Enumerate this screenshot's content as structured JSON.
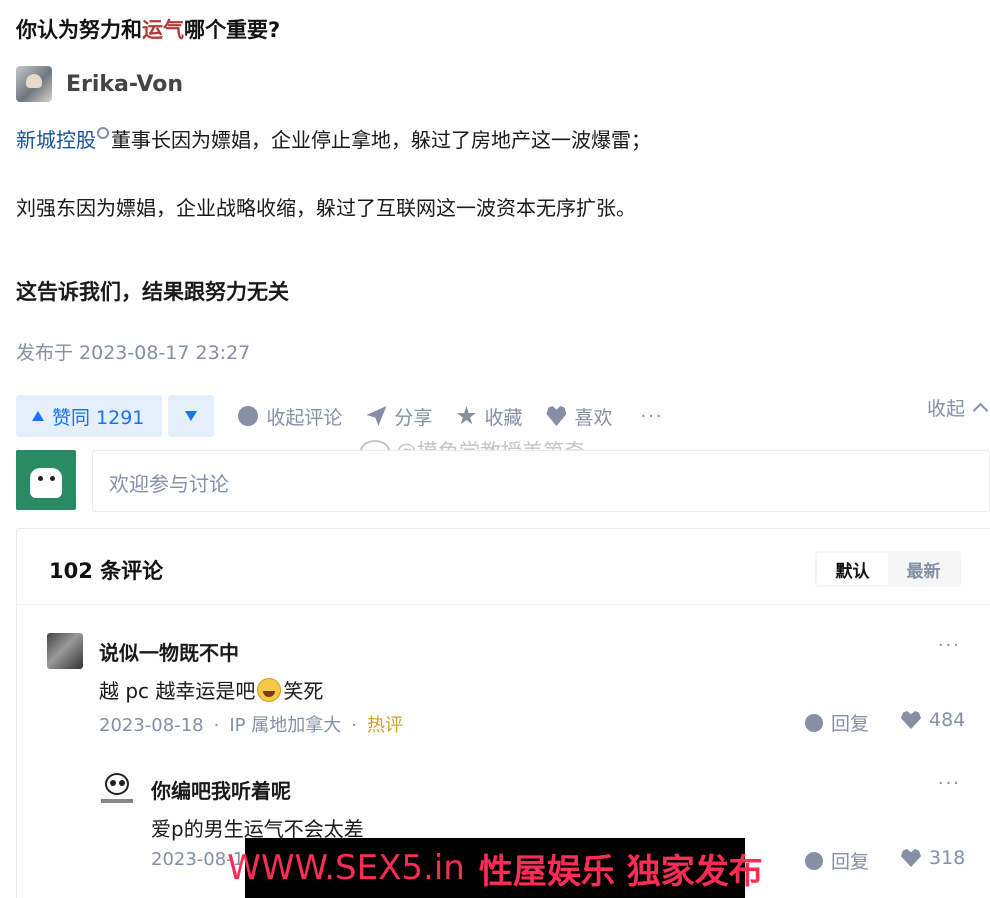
{
  "question": {
    "title_before": "你认为努力和",
    "title_highlight": "运气",
    "title_after": "哪个重要?"
  },
  "author": {
    "name": "Erika-Von"
  },
  "answer": {
    "p1_link": "新城控股",
    "p1_rest": "董事长因为嫖娼，企业停止拿地，躲过了房地产这一波爆雷；",
    "p2": "刘强东因为嫖娼，企业战略收缩，躲过了互联网这一波资本无序扩张。",
    "p3": "这告诉我们，结果跟努力无关",
    "published": "发布于 2023-08-17 23:27"
  },
  "actions": {
    "upvote": "赞同 1291",
    "collapse_comments": "收起评论",
    "share": "分享",
    "favorite": "收藏",
    "like": "喜欢",
    "more": "···",
    "collapse": "收起"
  },
  "watermark": "@摸鱼学教授美第奇",
  "comment_input": {
    "placeholder": "欢迎参与讨论"
  },
  "comments": {
    "count_label": "102 条评论",
    "sort_default": "默认",
    "sort_latest": "最新",
    "items": [
      {
        "name": "说似一物既不中",
        "text_before": "越 pc 越幸运是吧",
        "text_after": "笑死",
        "date": "2023-08-18",
        "location": "IP 属地加拿大",
        "badge": "热评",
        "reply": "回复",
        "likes": "484",
        "more": "···"
      },
      {
        "name": "你编吧我听着呢",
        "text": "爱p的男生运气不会太差",
        "date": "2023-08-1",
        "reply": "回复",
        "likes": "318",
        "more": "···"
      }
    ]
  },
  "promo": {
    "url": "WWW.SEX5.in",
    "slogan": "性屋娱乐 独家发布"
  }
}
